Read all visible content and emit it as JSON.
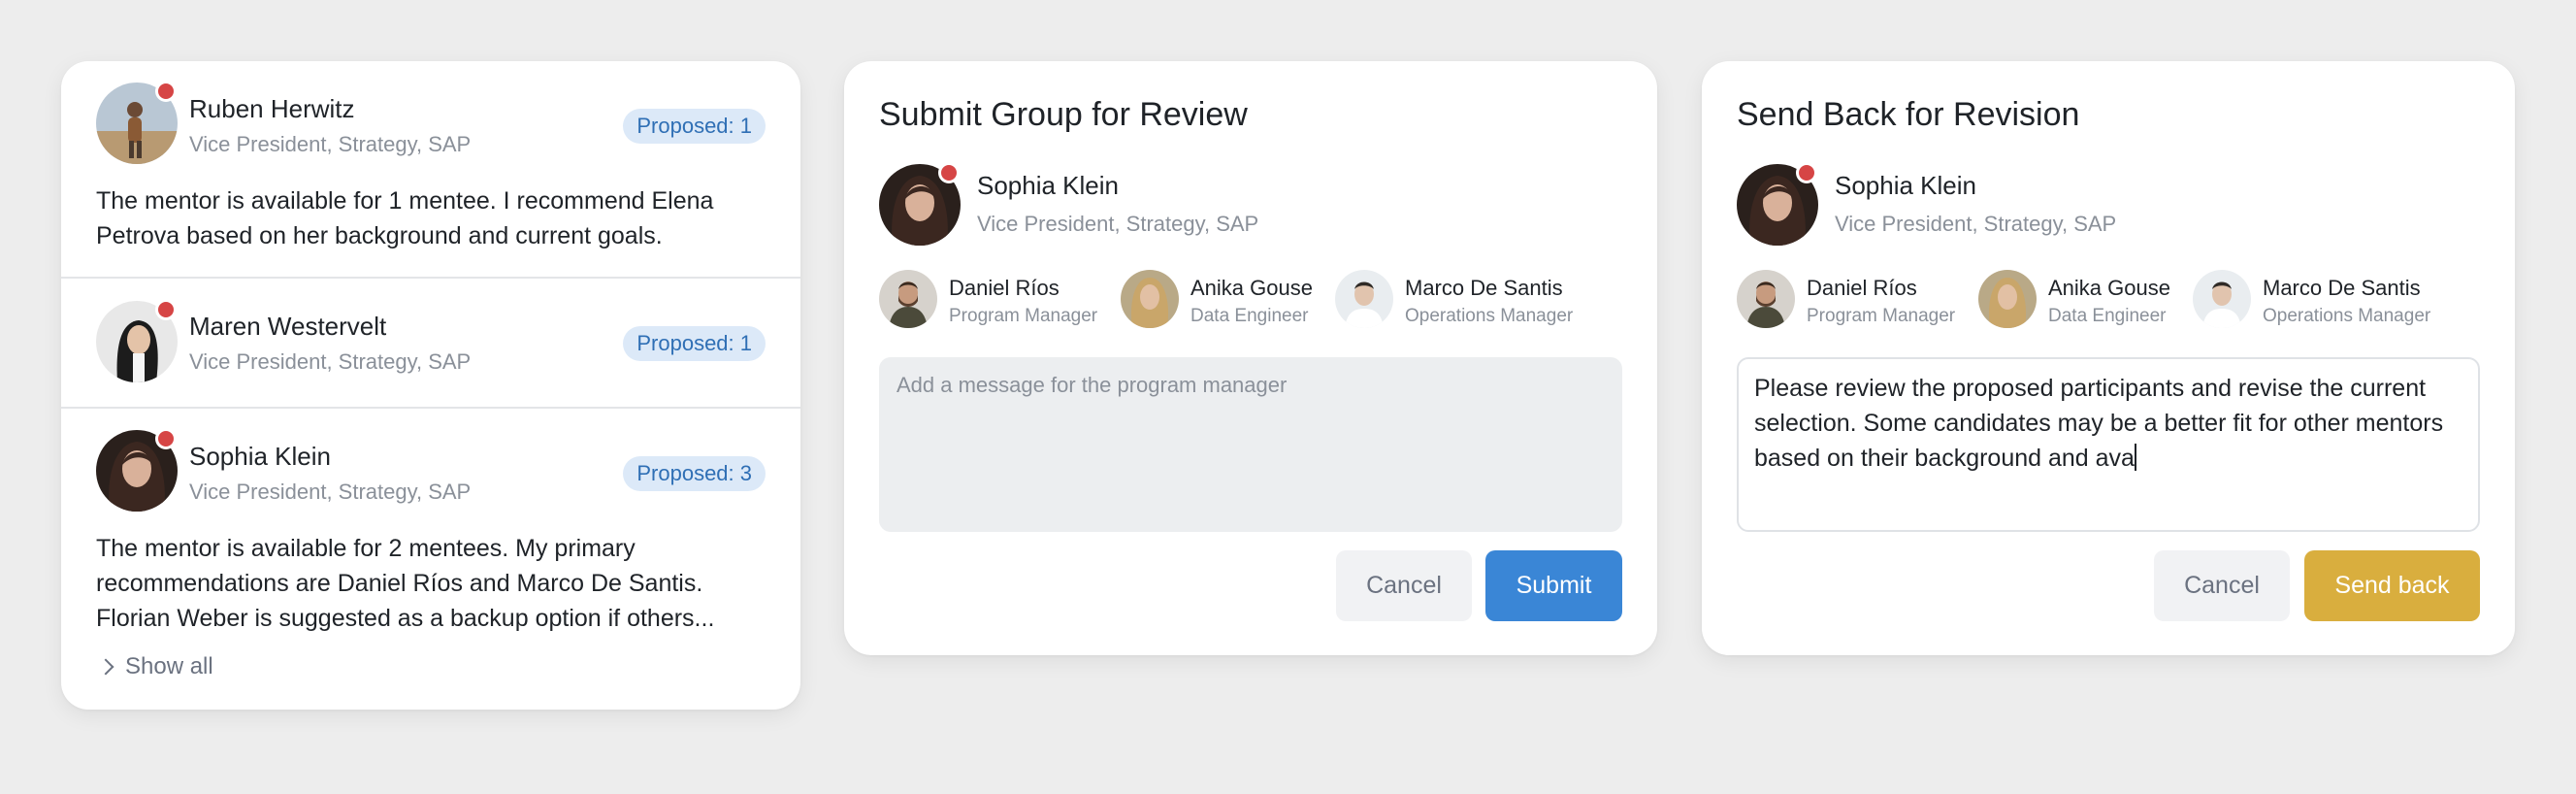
{
  "list": {
    "mentors": [
      {
        "name": "Ruben Herwitz",
        "role": "Vice President, Strategy, SAP",
        "badge": "Proposed: 1",
        "text": "The mentor is available for 1 mentee. I recommend Elena Petrova based on her background and current goals."
      },
      {
        "name": "Maren Westervelt",
        "role": "Vice President, Strategy, SAP",
        "badge": "Proposed: 1",
        "text": ""
      },
      {
        "name": "Sophia Klein",
        "role": "Vice President, Strategy, SAP",
        "badge": "Proposed: 3",
        "text": "The mentor is available for 2 mentees. My primary recommendations are Daniel Ríos and Marco De Santis. Florian Weber is suggested as a backup option if others..."
      }
    ],
    "show_all": "Show all"
  },
  "submit": {
    "title": "Submit Group for Review",
    "mentor": {
      "name": "Sophia Klein",
      "role": "Vice President, Strategy, SAP"
    },
    "participants": [
      {
        "name": "Daniel Ríos",
        "role": "Program Manager"
      },
      {
        "name": "Anika Gouse",
        "role": "Data Engineer"
      },
      {
        "name": "Marco De Santis",
        "role": "Operations Manager"
      }
    ],
    "message_placeholder": "Add a message for the program manager",
    "cancel_label": "Cancel",
    "submit_label": "Submit",
    "accent": "#3a86d6"
  },
  "sendback": {
    "title": "Send Back for Revision",
    "mentor": {
      "name": "Sophia Klein",
      "role": "Vice President, Strategy, SAP"
    },
    "participants": [
      {
        "name": "Daniel Ríos",
        "role": "Program Manager"
      },
      {
        "name": "Anika Gouse",
        "role": "Data Engineer"
      },
      {
        "name": "Marco De Santis",
        "role": "Operations Manager"
      }
    ],
    "message_value": "Please review the proposed participants and revise the current selection. Some candidates may be a better fit for other mentors based on their background and ava",
    "cancel_label": "Cancel",
    "send_label": "Send back",
    "accent": "#d9ae3e"
  },
  "colors": {
    "badge_bg": "#dce9f8",
    "badge_text": "#2f6fb5",
    "status_dot": "#d64545"
  }
}
